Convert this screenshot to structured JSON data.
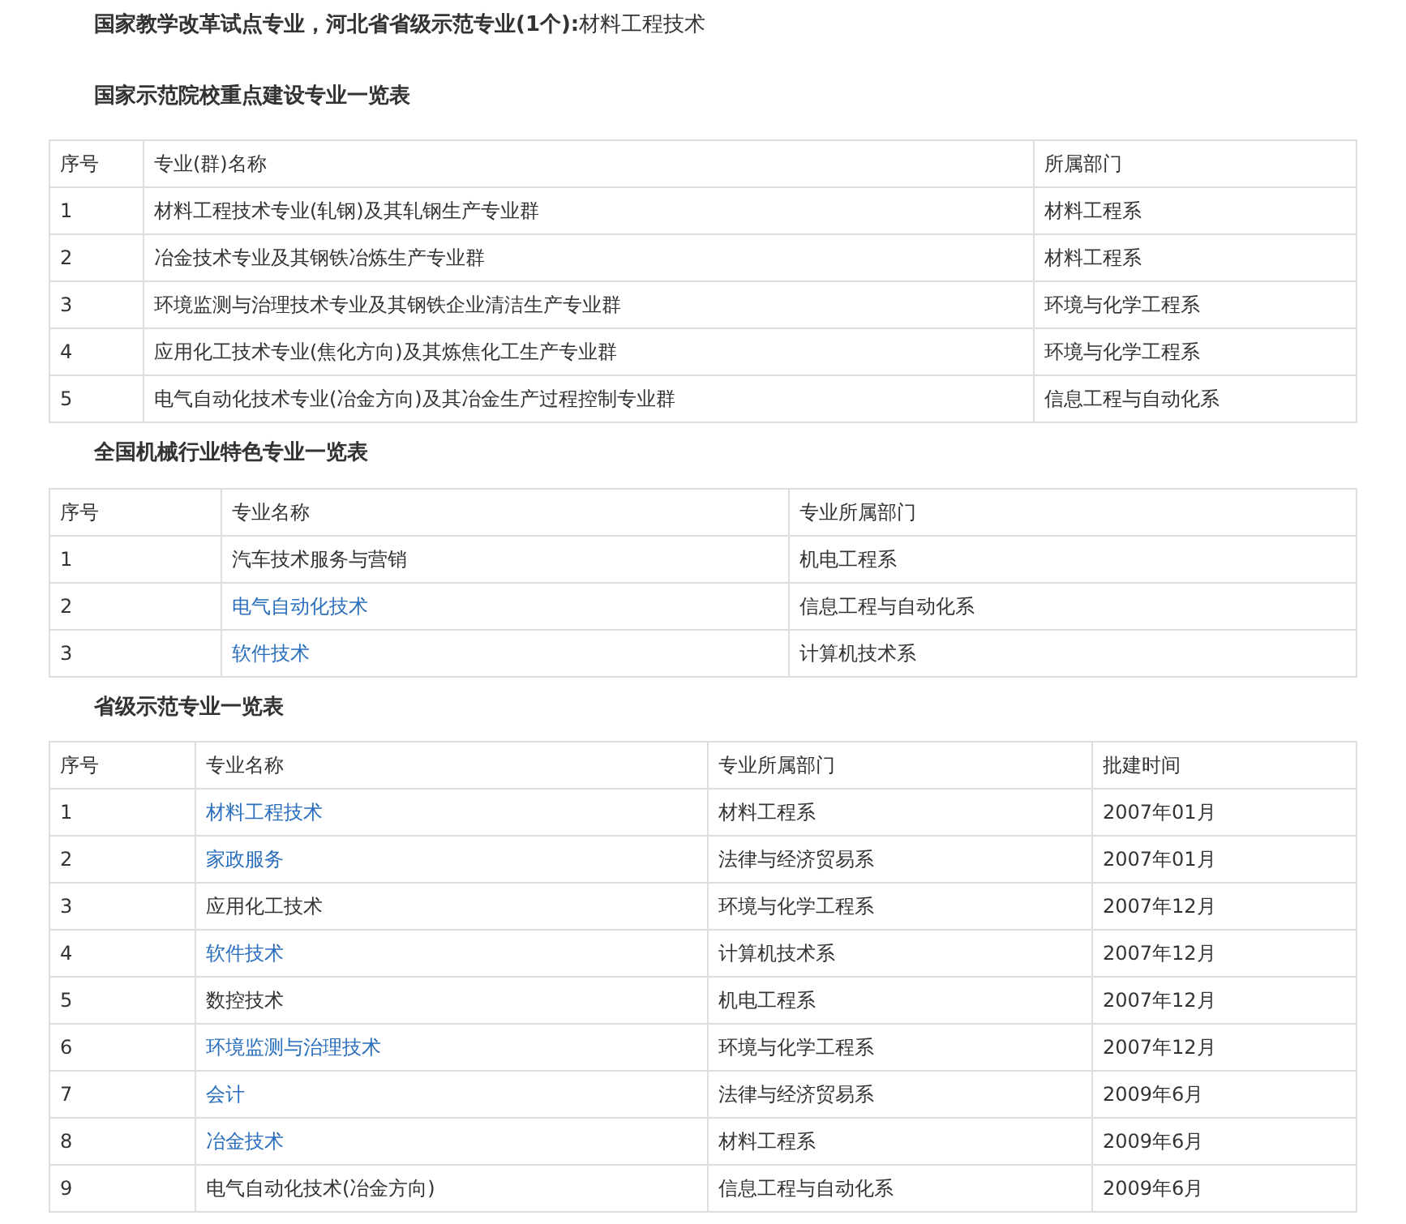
{
  "intro": "**国家教学改革试点专业，河北省省级示范专业(1个):**材料工程技术",
  "sections": [
    {
      "heading": "国家示范院校重点建设专业一览表",
      "columns": [
        "序号",
        "专业(群)名称",
        "所属部门"
      ],
      "rows": [
        {
          "cells": [
            {
              "text": "1",
              "link": false
            },
            {
              "text": "材料工程技术专业(轧钢)及其轧钢生产专业群",
              "link": false
            },
            {
              "text": "材料工程系",
              "link": false
            }
          ]
        },
        {
          "cells": [
            {
              "text": "2",
              "link": false
            },
            {
              "text": "冶金技术专业及其钢铁冶炼生产专业群",
              "link": false
            },
            {
              "text": "材料工程系",
              "link": false
            }
          ]
        },
        {
          "cells": [
            {
              "text": "3",
              "link": false
            },
            {
              "text": "环境监测与治理技术专业及其钢铁企业清洁生产专业群",
              "link": false
            },
            {
              "text": "环境与化学工程系",
              "link": false
            }
          ]
        },
        {
          "cells": [
            {
              "text": "4",
              "link": false
            },
            {
              "text": "应用化工技术专业(焦化方向)及其炼焦化工生产专业群",
              "link": false
            },
            {
              "text": "环境与化学工程系",
              "link": false
            }
          ]
        },
        {
          "cells": [
            {
              "text": "5",
              "link": false
            },
            {
              "text": "电气自动化技术专业(冶金方向)及其冶金生产过程控制专业群",
              "link": false
            },
            {
              "text": "信息工程与自动化系",
              "link": false
            }
          ]
        }
      ]
    },
    {
      "heading": "全国机械行业特色专业一览表",
      "columns": [
        "序号",
        "专业名称",
        "专业所属部门"
      ],
      "rows": [
        {
          "cells": [
            {
              "text": "1",
              "link": false
            },
            {
              "text": "汽车技术服务与营销",
              "link": false
            },
            {
              "text": "机电工程系",
              "link": false
            }
          ]
        },
        {
          "cells": [
            {
              "text": "2",
              "link": false
            },
            {
              "text": "电气自动化技术",
              "link": true
            },
            {
              "text": "信息工程与自动化系",
              "link": false
            }
          ]
        },
        {
          "cells": [
            {
              "text": "3",
              "link": false
            },
            {
              "text": "软件技术",
              "link": true
            },
            {
              "text": "计算机技术系",
              "link": false
            }
          ]
        }
      ]
    },
    {
      "heading": "省级示范专业一览表",
      "columns": [
        "序号",
        "专业名称",
        "专业所属部门",
        "批建时间"
      ],
      "rows": [
        {
          "cells": [
            {
              "text": "1",
              "link": false
            },
            {
              "text": "材料工程技术",
              "link": true
            },
            {
              "text": "材料工程系",
              "link": false
            },
            {
              "text": "2007年01月",
              "link": false
            }
          ]
        },
        {
          "cells": [
            {
              "text": "2",
              "link": false
            },
            {
              "text": "家政服务",
              "link": true
            },
            {
              "text": "法律与经济贸易系",
              "link": false
            },
            {
              "text": "2007年01月",
              "link": false
            }
          ]
        },
        {
          "cells": [
            {
              "text": "3",
              "link": false
            },
            {
              "text": "应用化工技术",
              "link": false
            },
            {
              "text": "环境与化学工程系",
              "link": false
            },
            {
              "text": "2007年12月",
              "link": false
            }
          ]
        },
        {
          "cells": [
            {
              "text": "4",
              "link": false
            },
            {
              "text": "软件技术",
              "link": true
            },
            {
              "text": "计算机技术系",
              "link": false
            },
            {
              "text": "2007年12月",
              "link": false
            }
          ]
        },
        {
          "cells": [
            {
              "text": "5",
              "link": false
            },
            {
              "text": "数控技术",
              "link": false
            },
            {
              "text": "机电工程系",
              "link": false
            },
            {
              "text": "2007年12月",
              "link": false
            }
          ]
        },
        {
          "cells": [
            {
              "text": "6",
              "link": false
            },
            {
              "text": "环境监测与治理技术",
              "link": true
            },
            {
              "text": "环境与化学工程系",
              "link": false
            },
            {
              "text": "2007年12月",
              "link": false
            }
          ]
        },
        {
          "cells": [
            {
              "text": "7",
              "link": false
            },
            {
              "text": "会计",
              "link": true
            },
            {
              "text": "法律与经济贸易系",
              "link": false
            },
            {
              "text": "2009年6月",
              "link": false
            }
          ]
        },
        {
          "cells": [
            {
              "text": "8",
              "link": false
            },
            {
              "text": "冶金技术",
              "link": true
            },
            {
              "text": "材料工程系",
              "link": false
            },
            {
              "text": "2009年6月",
              "link": false
            }
          ]
        },
        {
          "cells": [
            {
              "text": "9",
              "link": false
            },
            {
              "text": "电气自动化技术(冶金方向)",
              "link": false
            },
            {
              "text": "信息工程与自动化系",
              "link": false
            },
            {
              "text": "2009年6月",
              "link": false
            }
          ]
        }
      ]
    }
  ]
}
